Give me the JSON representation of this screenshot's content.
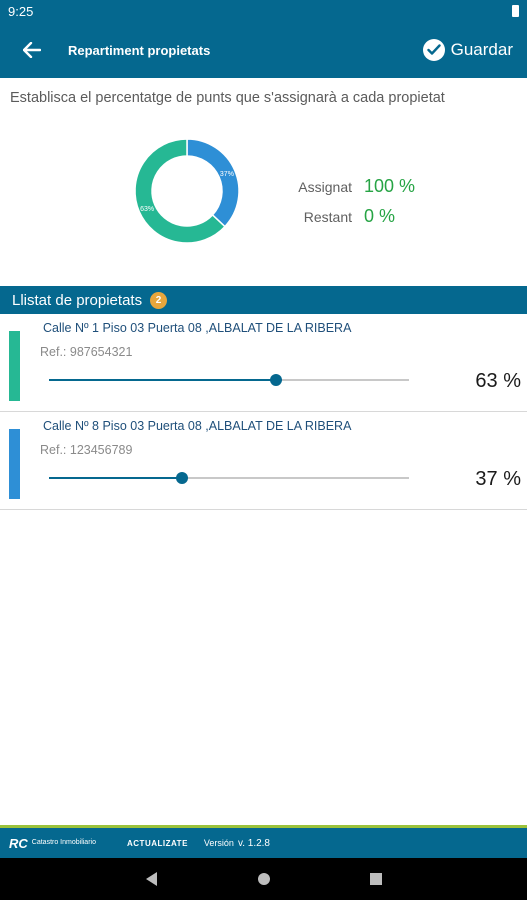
{
  "status_bar": {
    "time": "9:25"
  },
  "app_bar": {
    "title": "Repartiment propietats",
    "save_label": "Guardar"
  },
  "instruction": "Establisca el percentatge de punts que s'assignarà a cada propietat",
  "summary": {
    "assigned_label": "Assignat",
    "assigned_value": "100 %",
    "remaining_label": "Restant",
    "remaining_value": "0 %"
  },
  "chart_data": {
    "type": "pie",
    "donut": true,
    "categories": [
      "Calle Nº 1 Piso 03 Puerta 08 ,ALBALAT DE LA RIBERA",
      "Calle Nº 8 Piso 03 Puerta 08 ,ALBALAT DE LA RIBERA"
    ],
    "values": [
      63,
      37
    ],
    "slice_labels": [
      "63%",
      "37%"
    ],
    "colors": [
      "#26b894",
      "#2e8fd6"
    ]
  },
  "list": {
    "header": "Llistat de propietats",
    "count": "2",
    "items": [
      {
        "address": "Calle Nº 1 Piso 03 Puerta 08 ,ALBALAT DE LA RIBERA",
        "ref": "Ref.: 987654321",
        "percent": "63 %",
        "value": 63,
        "color": "#26b894"
      },
      {
        "address": "Calle Nº 8 Piso 03 Puerta 08 ,ALBALAT DE LA RIBERA",
        "ref": "Ref.: 123456789",
        "percent": "37 %",
        "value": 37,
        "color": "#2e8fd6"
      }
    ]
  },
  "footer": {
    "logo_mark": "RC",
    "logo_text": "Catastro Inmobiliario",
    "brand": "ACTUALIZATE",
    "version_label": "Versión",
    "version": "v. 1.2.8"
  },
  "colors": {
    "primary": "#05688f",
    "accent_green": "#27a445",
    "badge": "#e8a63c",
    "footer_stripe": "#9cc23b"
  },
  "icons": {
    "back": "arrow-left-icon",
    "save": "check-circle-icon"
  }
}
